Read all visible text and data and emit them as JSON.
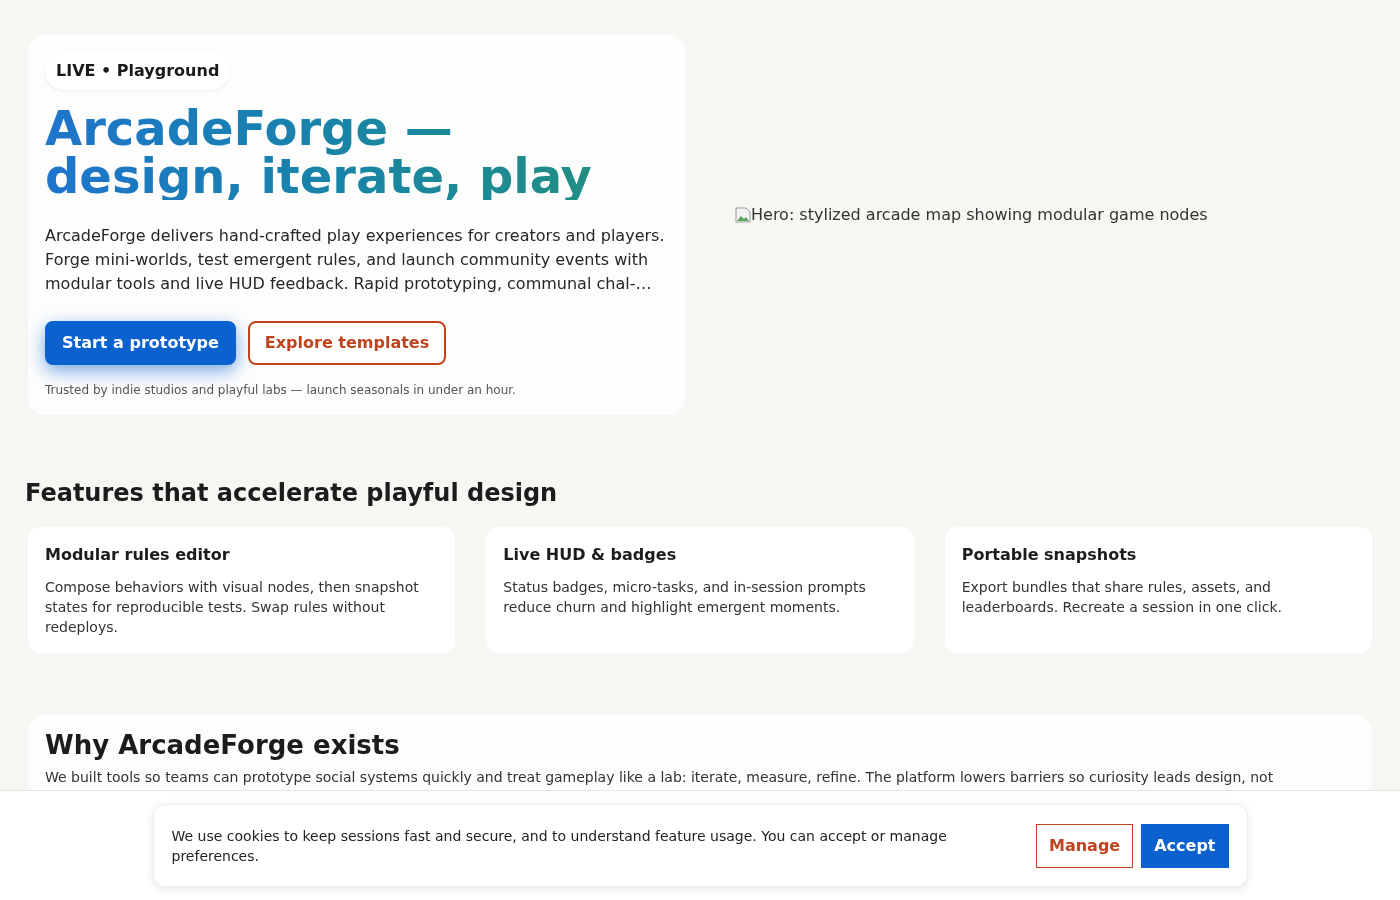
{
  "hero": {
    "badge": "LIVE • Playground",
    "title": "ArcadeForge — design, iterate, play",
    "description": "ArcadeForge delivers hand-crafted play experiences for creators and players. Forge mini-worlds, test emergent rules, and launch community events with modular tools and live HUD feedback. Rapid prototyping, communal chal-…",
    "buttons": [
      {
        "label": "Start a prototype",
        "kind": "primary"
      },
      {
        "label": "Explore templates",
        "kind": "outline"
      }
    ],
    "note": "Trusted by indie studios and playful labs — launch seasonals in under an hour.",
    "image_alt": "Hero: stylized arcade map showing modular game nodes"
  },
  "features": {
    "heading": "Features that accelerate playful design",
    "cards": [
      {
        "title": "Modular rules editor",
        "text": "Compose behaviors with visual nodes, then snapshot states for reproducible tests. Swap rules without redeploys."
      },
      {
        "title": "Live HUD & badges",
        "text": "Status badges, micro-tasks, and in-session prompts reduce churn and highlight emergent moments."
      },
      {
        "title": "Portable snapshots",
        "text": "Export bundles that share rules, assets, and leaderboards. Recreate a session in one click."
      }
    ]
  },
  "why": {
    "heading": "Why ArcadeForge exists",
    "text": "We built tools so teams can prototype social systems quickly and treat gameplay like a lab: iterate, measure, refine. The platform lowers barriers so curiosity leads design, not"
  },
  "cookie_banner": {
    "text": "We use cookies to keep sessions fast and secure, and to understand feature usage. You can accept or manage preferences.",
    "buttons": [
      {
        "label": "Manage",
        "kind": "outline"
      },
      {
        "label": "Accept",
        "kind": "primary"
      }
    ]
  }
}
